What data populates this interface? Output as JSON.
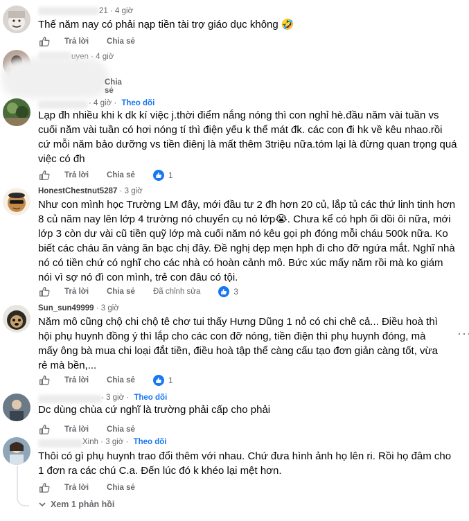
{
  "labels": {
    "reply": "Trả lời",
    "share": "Chia sẻ",
    "follow": "Theo dõi",
    "edited": "Đã chỉnh sửa"
  },
  "comments": [
    {
      "name_partial": "21",
      "time": "4 giờ",
      "text": "Thế năm nay có phải nạp tiền tài trợ giáo dục không 🤣"
    },
    {
      "name_partial": "uyen",
      "time": "4 giờ"
    },
    {
      "time": "4 giờ",
      "text": "Lạp đh nhiều khi k dk kí việc j.thời điểm nắng nóng thì con nghỉ hè.đầu năm vài tuần vs cuối năm vài tuần có hơi nóng tí thì điện yếu k thể mát đk. các con đi hk về kêu nhao.rồi cứ mỗi năm bảo dưỡng vs tiền điênj là mất thêm 3triệu nữa.tóm lại là đừng quan trọng quá việc có đh",
      "reactions": "1"
    },
    {
      "name": "HonestChestnut5287",
      "time": "3 giờ",
      "text": "Như con mình học Trường LM đây, mới đầu tư 2 đh hơn 20 củ, lắp tủ các thứ linh tinh hơn 8 củ năm nay lên lớp 4 trường nó chuyển cụ nó lớp😭. Chưa kể có hph ối dồi ôi nữa, mới lớp 3 còn dư vài cũ tiền quỹ lớp mà cuối năm nó kêu gọi ph đóng mỗi cháu 500k nữa. Ko biết các cháu ăn vàng ăn bạc chị đây. Đề nghị dẹp mẹn hph đi cho đỡ ngứa mắt. Nghĩ nhà nó có tiền chứ có nghĩ cho các nhà có hoàn cảnh mô. Bức xúc mấy năm rồi mà ko giám nói vì sợ nó đì con mình, trẻ con đâu có tội.",
      "reactions": "3"
    },
    {
      "name": "Sun_sun49999",
      "time": "3 giờ",
      "text": "Năm mô cũng chộ chi chộ tê chơ tui thấy Hưng Dũng 1 nỏ có chi chê cả... Điều hoà thì hội phụ huynh đồng ý thì lắp cho các con đỡ nóng, tiền điện thì phụ huynh đóng, mà mấy ông bà mua chi loại đắt tiền, điều hoà tập thể càng cấu tạo đơn giản càng tốt, vừa rẻ mà bền,...",
      "reactions": "1"
    },
    {
      "time": "3 giờ",
      "text": "Dc dùng chùa cứ nghĩ là trường phải cấp cho phải"
    },
    {
      "name_partial": "Xinh",
      "time": "3 giờ",
      "text": "Thôi có gì phụ huynh trao đổi thêm với nhau. Chứ đưa hình ảnh họ lên ri. Rồi họ đâm cho 1 đơn ra các chú C.a. Đến lúc đó k khéo lại mệt hơn."
    }
  ],
  "view_replies": "Xem 1 phản hồi"
}
